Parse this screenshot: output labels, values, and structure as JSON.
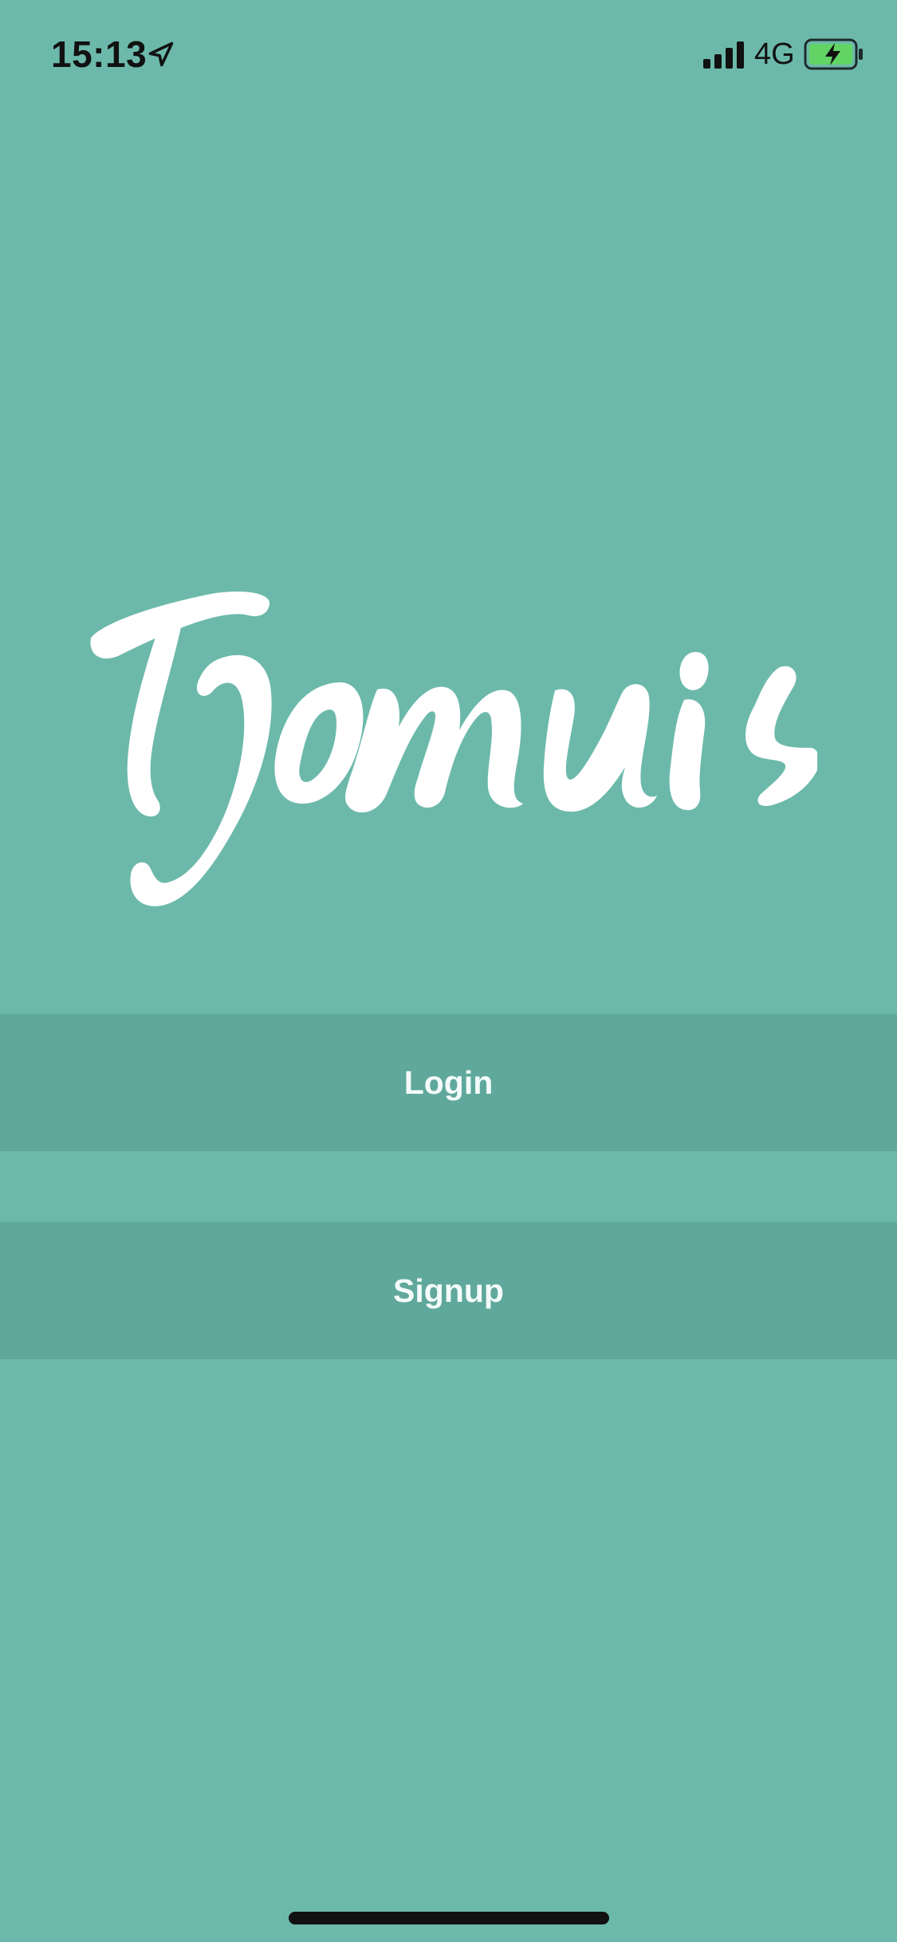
{
  "status_bar": {
    "time": "15:13",
    "network": "4G",
    "icons": [
      "location-arrow-icon",
      "signal-bars-icon",
      "battery-charging-icon"
    ]
  },
  "app": {
    "logo_text": "Tjommis"
  },
  "actions": {
    "login_label": "Login",
    "signup_label": "Signup"
  },
  "colors": {
    "background": "#6cb9ab",
    "button_background": "#5fa89b",
    "text": "#ffffff"
  }
}
